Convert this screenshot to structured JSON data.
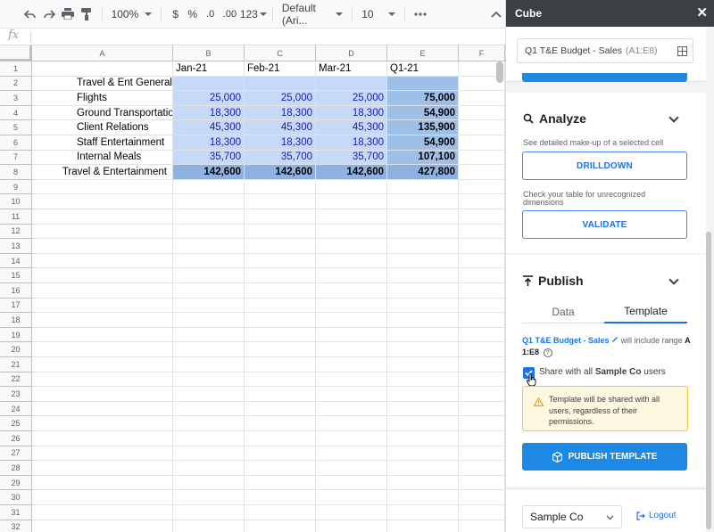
{
  "toolbar": {
    "zoom": "100%",
    "currency": "$",
    "percent": "%",
    "dec_decrease": ".0",
    "dec_increase": ".00",
    "number_format": "123",
    "font": "Default (Ari...",
    "font_size": "10"
  },
  "formula_bar": {
    "fx": "fx",
    "value": ""
  },
  "sheet": {
    "columns": [
      "A",
      "B",
      "C",
      "D",
      "E",
      "F"
    ],
    "row_numbers": [
      "1",
      "2",
      "3",
      "4",
      "5",
      "6",
      "7",
      "8",
      "9",
      "10",
      "11",
      "12",
      "13",
      "14",
      "15",
      "16",
      "17",
      "18",
      "19",
      "20",
      "21",
      "22",
      "23",
      "24",
      "25",
      "26",
      "27",
      "28",
      "29",
      "30",
      "31",
      "32"
    ],
    "rows": [
      [
        "",
        "Jan-21",
        "Feb-21",
        "Mar-21",
        "Q1-21"
      ],
      [
        "Travel & Ent General",
        "",
        "",
        "",
        ""
      ],
      [
        "Flights",
        "25,000",
        "25,000",
        "25,000",
        "75,000"
      ],
      [
        "Ground Transportation",
        "18,300",
        "18,300",
        "18,300",
        "54,900"
      ],
      [
        "Client Relations",
        "45,300",
        "45,300",
        "45,300",
        "135,900"
      ],
      [
        "Staff Entertainment",
        "18,300",
        "18,300",
        "18,300",
        "54,900"
      ],
      [
        "Internal Meals",
        "35,700",
        "35,700",
        "35,700",
        "107,100"
      ],
      [
        "Travel & Entertainment",
        "142,600",
        "142,600",
        "142,600",
        "427,800"
      ]
    ]
  },
  "panel": {
    "title": "Cube",
    "close": "✕",
    "range": {
      "name": "Q1 T&E Budget - Sales",
      "address": "(A1:E8)"
    },
    "analyze": {
      "title": "Analyze",
      "drill_desc": "See detailed make-up of a selected cell",
      "drill_label": "DRILLDOWN",
      "validate_desc": "Check your table for unrecognized dimensions",
      "validate_label": "VALIDATE"
    },
    "publish": {
      "title": "Publish",
      "tabs": [
        "Data",
        "Template"
      ],
      "active_tab": "Template",
      "range_link": "Q1 T&E Budget - Sales",
      "range_text": "will include range",
      "range_bold_1": "A",
      "range_bold_2": "1:E8",
      "help": "?",
      "share_prefix": "Share with all",
      "share_org": "Sample Co",
      "share_suffix": "users",
      "share_checked": true,
      "warning": "Template will be shared with all users, regardless of their permissions.",
      "button": "PUBLISH TEMPLATE"
    },
    "footer": {
      "org": "Sample Co",
      "logout": "Logout"
    }
  },
  "colors": {
    "accent": "#1a73e8",
    "publish": "#1e88e5",
    "range_light": "#c6d9f7",
    "range_dark": "#9dbfe8",
    "header_bg": "#3c4043"
  }
}
